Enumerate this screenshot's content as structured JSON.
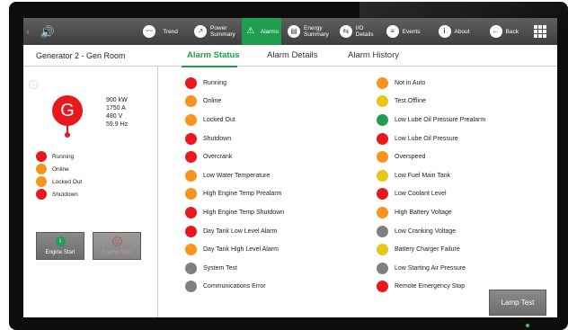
{
  "nav": {
    "items": [
      {
        "label": "Trend",
        "icon": "trend-icon",
        "glyph": "〰"
      },
      {
        "label": "Power\nSummary",
        "icon": "power-summary-icon",
        "glyph": "↗"
      },
      {
        "label": "Alarms",
        "icon": "alarm-warning-icon",
        "glyph": "⚠",
        "active": true
      },
      {
        "label": "Energy\nSummary",
        "icon": "energy-summary-icon",
        "glyph": "▤"
      },
      {
        "label": "I/O\nDetails",
        "icon": "io-details-icon",
        "glyph": "⇆"
      },
      {
        "label": "Events",
        "icon": "events-icon",
        "glyph": "≡"
      },
      {
        "label": "About",
        "icon": "info-icon",
        "glyph": "i"
      },
      {
        "label": "Back",
        "icon": "back-arrow-icon",
        "glyph": "←"
      }
    ]
  },
  "header": {
    "page_title": "Generator 2 - Gen Room",
    "tabs": [
      {
        "label": "Alarm Status",
        "active": true
      },
      {
        "label": "Alarm Details",
        "active": false
      },
      {
        "label": "Alarm History",
        "active": false
      }
    ]
  },
  "generator": {
    "symbol": "G",
    "readings": [
      "900 kW",
      "1750 A",
      "480 V",
      "59.9 Hz"
    ],
    "status": [
      {
        "label": "Running",
        "color": "red"
      },
      {
        "label": "Online",
        "color": "orange"
      },
      {
        "label": "Locked Out",
        "color": "orange"
      },
      {
        "label": "Shutdown",
        "color": "red"
      }
    ]
  },
  "controls": {
    "start_label": "Engine Start",
    "stop_label": "Engine Stop"
  },
  "alarms": {
    "column1": [
      {
        "label": "Running",
        "color": "red"
      },
      {
        "label": "Online",
        "color": "orange"
      },
      {
        "label": "Locked Out",
        "color": "orange"
      },
      {
        "label": "Shutdown",
        "color": "red"
      },
      {
        "label": "Overcrank",
        "color": "red"
      },
      {
        "label": "Low Water Temperature",
        "color": "orange"
      },
      {
        "label": "High Engine Temp Prealarm",
        "color": "orange"
      },
      {
        "label": "High Engine Temp Shutdown",
        "color": "red"
      },
      {
        "label": "Day Tank Low Level Alarm",
        "color": "red"
      },
      {
        "label": "Day Tank High Level Alarm",
        "color": "orange"
      },
      {
        "label": "System Test",
        "color": "gray"
      },
      {
        "label": "Communications Error",
        "color": "gray"
      }
    ],
    "column2": [
      {
        "label": "Not in Auto",
        "color": "orange"
      },
      {
        "label": "Test Offline",
        "color": "yellow"
      },
      {
        "label": "Low Lube Oil Pressure Prealarm",
        "color": "green"
      },
      {
        "label": "Low Lube Oil Pressure",
        "color": "red"
      },
      {
        "label": "Overspeed",
        "color": "orange"
      },
      {
        "label": "Low Fuel Main Tank",
        "color": "yellow"
      },
      {
        "label": "Low Coolant Level",
        "color": "red"
      },
      {
        "label": "High Battery Voltage",
        "color": "orange"
      },
      {
        "label": "Low Cranking Voltage",
        "color": "gray"
      },
      {
        "label": "Battery Charger Failure",
        "color": "yellow"
      },
      {
        "label": "Low Starting Air Pressure",
        "color": "gray"
      },
      {
        "label": "Remote Emergency Stop",
        "color": "red"
      }
    ]
  },
  "lamp_test_label": "Lamp Test",
  "colors": {
    "red": "#e8181d",
    "orange": "#f7941d",
    "yellow": "#e8c816",
    "green": "#1e9e4e",
    "gray": "#7f7f7f",
    "accent": "#1e9e4e"
  }
}
